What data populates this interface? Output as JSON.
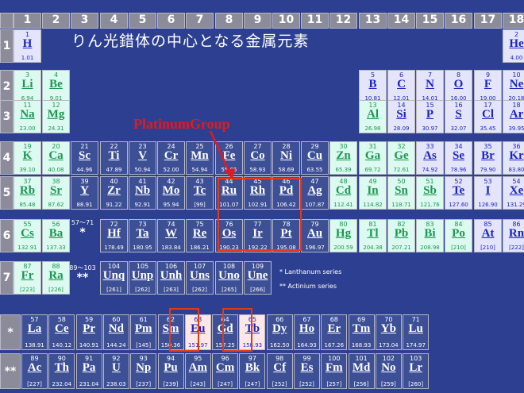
{
  "title": "りん光錯体の中心となる金属元素",
  "annotation": "PlatinumGroup",
  "groups": [
    "1",
    "2",
    "3",
    "4",
    "5",
    "6",
    "7",
    "8",
    "9",
    "10",
    "11",
    "12",
    "13",
    "14",
    "15",
    "16",
    "17",
    "18"
  ],
  "periods": [
    "1",
    "2",
    "3",
    "4",
    "5",
    "6",
    "7"
  ],
  "series_labels": {
    "lanthanide": "*",
    "actinide": "**"
  },
  "placeholders": {
    "la": {
      "num": "57～71",
      "mark": "*"
    },
    "ac": {
      "num": "89～103",
      "mark": "**"
    }
  },
  "legend": {
    "lan": "*  Lanthanum series",
    "act": "** Actinium series"
  },
  "elements": [
    [
      "1",
      "H",
      "1.01"
    ],
    [
      "2",
      "He",
      "4.00"
    ],
    [
      "3",
      "Li",
      "6.94"
    ],
    [
      "4",
      "Be",
      "9.01"
    ],
    [
      "5",
      "B",
      "10.81"
    ],
    [
      "6",
      "C",
      "12.01"
    ],
    [
      "7",
      "N",
      "14.01"
    ],
    [
      "8",
      "O",
      "16.00"
    ],
    [
      "9",
      "F",
      "19.00"
    ],
    [
      "10",
      "Ne",
      "20.18"
    ],
    [
      "11",
      "Na",
      "23.00"
    ],
    [
      "12",
      "Mg",
      "24.31"
    ],
    [
      "13",
      "Al",
      "26.98"
    ],
    [
      "14",
      "Si",
      "28.09"
    ],
    [
      "15",
      "P",
      "30.97"
    ],
    [
      "16",
      "S",
      "32.07"
    ],
    [
      "17",
      "Cl",
      "35.45"
    ],
    [
      "18",
      "Ar",
      "39.95"
    ],
    [
      "19",
      "K",
      "39.10"
    ],
    [
      "20",
      "Ca",
      "40.08"
    ],
    [
      "21",
      "Sc",
      "44.96"
    ],
    [
      "22",
      "Ti",
      "47.89"
    ],
    [
      "23",
      "V",
      "50.94"
    ],
    [
      "24",
      "Cr",
      "52.00"
    ],
    [
      "25",
      "Mn",
      "54.94"
    ],
    [
      "26",
      "Fe",
      "55.85"
    ],
    [
      "27",
      "Co",
      "58.93"
    ],
    [
      "28",
      "Ni",
      "58.69"
    ],
    [
      "29",
      "Cu",
      "63.55"
    ],
    [
      "30",
      "Zn",
      "65.39"
    ],
    [
      "31",
      "Ga",
      "69.72"
    ],
    [
      "32",
      "Ge",
      "72.61"
    ],
    [
      "33",
      "As",
      "74.92"
    ],
    [
      "34",
      "Se",
      "78.96"
    ],
    [
      "35",
      "Br",
      "79.90"
    ],
    [
      "36",
      "Kr",
      "83.80"
    ],
    [
      "37",
      "Rb",
      "85.48"
    ],
    [
      "38",
      "Sr",
      "87.62"
    ],
    [
      "39",
      "Y",
      "88.91"
    ],
    [
      "40",
      "Zr",
      "91.22"
    ],
    [
      "41",
      "Nb",
      "92.91"
    ],
    [
      "42",
      "Mo",
      "95.94"
    ],
    [
      "43",
      "Tc",
      "[99]"
    ],
    [
      "44",
      "Ru",
      "101.07"
    ],
    [
      "45",
      "Rh",
      "102.91"
    ],
    [
      "46",
      "Pd",
      "106.42"
    ],
    [
      "47",
      "Ag",
      "107.87"
    ],
    [
      "48",
      "Cd",
      "112.41"
    ],
    [
      "49",
      "In",
      "114.82"
    ],
    [
      "50",
      "Sn",
      "118.71"
    ],
    [
      "51",
      "Sb",
      "121.76"
    ],
    [
      "52",
      "Te",
      "127.60"
    ],
    [
      "53",
      "I",
      "126.90"
    ],
    [
      "54",
      "Xe",
      "131.29"
    ],
    [
      "55",
      "Cs",
      "132.91"
    ],
    [
      "56",
      "Ba",
      "137.33"
    ],
    [
      "72",
      "Hf",
      "178.49"
    ],
    [
      "73",
      "Ta",
      "180.95"
    ],
    [
      "74",
      "W",
      "183.84"
    ],
    [
      "75",
      "Re",
      "186.21"
    ],
    [
      "76",
      "Os",
      "190.23"
    ],
    [
      "77",
      "Ir",
      "192.22"
    ],
    [
      "78",
      "Pt",
      "195.08"
    ],
    [
      "79",
      "Au",
      "196.97"
    ],
    [
      "80",
      "Hg",
      "200.59"
    ],
    [
      "81",
      "Tl",
      "204.38"
    ],
    [
      "82",
      "Pb",
      "207.21"
    ],
    [
      "83",
      "Bi",
      "208.98"
    ],
    [
      "84",
      "Po",
      "[210]"
    ],
    [
      "85",
      "At",
      "[210]"
    ],
    [
      "86",
      "Rn",
      "[222]"
    ],
    [
      "87",
      "Fr",
      "[223]"
    ],
    [
      "88",
      "Ra",
      "[226]"
    ],
    [
      "104",
      "Unq",
      "[261]"
    ],
    [
      "105",
      "Unp",
      "[262]"
    ],
    [
      "106",
      "Unh",
      "[263]"
    ],
    [
      "107",
      "Uns",
      "[262]"
    ],
    [
      "108",
      "Uno",
      "[265]"
    ],
    [
      "109",
      "Une",
      "[266]"
    ],
    [
      "57",
      "La",
      "138.91"
    ],
    [
      "58",
      "Ce",
      "140.12"
    ],
    [
      "59",
      "Pr",
      "140.91"
    ],
    [
      "60",
      "Nd",
      "144.24"
    ],
    [
      "61",
      "Pm",
      "[145]"
    ],
    [
      "62",
      "Sm",
      "150.36"
    ],
    [
      "63",
      "Eu",
      "151.97"
    ],
    [
      "64",
      "Gd",
      "157.25"
    ],
    [
      "65",
      "Tb",
      "158.93"
    ],
    [
      "66",
      "Dy",
      "162.50"
    ],
    [
      "67",
      "Ho",
      "164.93"
    ],
    [
      "68",
      "Er",
      "167.26"
    ],
    [
      "69",
      "Tm",
      "168.93"
    ],
    [
      "70",
      "Yb",
      "173.04"
    ],
    [
      "71",
      "Lu",
      "174.97"
    ],
    [
      "89",
      "Ac",
      "[227]"
    ],
    [
      "90",
      "Th",
      "232.04"
    ],
    [
      "91",
      "Pa",
      "231.04"
    ],
    [
      "92",
      "U",
      "238.03"
    ],
    [
      "93",
      "Np",
      "[237]"
    ],
    [
      "94",
      "Pu",
      "[239]"
    ],
    [
      "95",
      "Am",
      "[243]"
    ],
    [
      "96",
      "Cm",
      "[247]"
    ],
    [
      "97",
      "Bk",
      "[247]"
    ],
    [
      "98",
      "Cf",
      "[252]"
    ],
    [
      "99",
      "Es",
      "[252]"
    ],
    [
      "100",
      "Fm",
      "[257]"
    ],
    [
      "101",
      "Md",
      "[256]"
    ],
    [
      "102",
      "No",
      "[259]"
    ],
    [
      "103",
      "Lr",
      "[260]"
    ]
  ]
}
